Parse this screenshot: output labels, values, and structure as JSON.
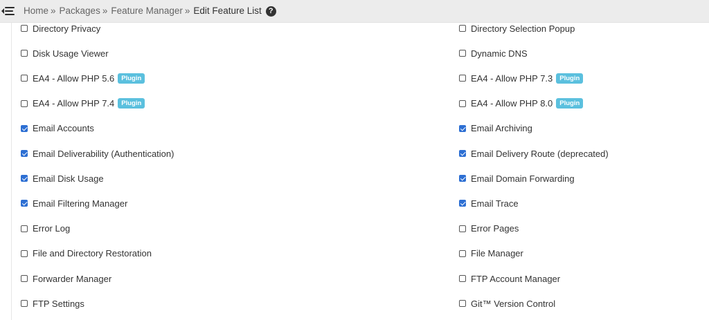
{
  "breadcrumb": {
    "home": "Home",
    "packages": "Packages",
    "feature_manager": "Feature Manager",
    "current": "Edit Feature List",
    "separator": "»"
  },
  "icons": {
    "menu": "menu-toggle-icon",
    "help": "question-circle-icon"
  },
  "help_glyph": "?",
  "colors": {
    "checkbox_checked": "#2d6fd3",
    "plugin_badge": "#5bc0de",
    "topbar": "#ececec"
  },
  "features": {
    "left": [
      {
        "label": "Directory Privacy",
        "checked": false,
        "badge": ""
      },
      {
        "label": "Disk Usage Viewer",
        "checked": false,
        "badge": ""
      },
      {
        "label": "EA4 - Allow PHP 5.6",
        "checked": false,
        "badge": "Plugin"
      },
      {
        "label": "EA4 - Allow PHP 7.4",
        "checked": false,
        "badge": "Plugin"
      },
      {
        "label": "Email Accounts",
        "checked": true,
        "badge": ""
      },
      {
        "label": "Email Deliverability (Authentication)",
        "checked": true,
        "badge": ""
      },
      {
        "label": "Email Disk Usage",
        "checked": true,
        "badge": ""
      },
      {
        "label": "Email Filtering Manager",
        "checked": true,
        "badge": ""
      },
      {
        "label": "Error Log",
        "checked": false,
        "badge": ""
      },
      {
        "label": "File and Directory Restoration",
        "checked": false,
        "badge": ""
      },
      {
        "label": "Forwarder Manager",
        "checked": false,
        "badge": ""
      },
      {
        "label": "FTP Settings",
        "checked": false,
        "badge": ""
      }
    ],
    "right": [
      {
        "label": "Directory Selection Popup",
        "checked": false,
        "badge": ""
      },
      {
        "label": "Dynamic DNS",
        "checked": false,
        "badge": ""
      },
      {
        "label": "EA4 - Allow PHP 7.3",
        "checked": false,
        "badge": "Plugin"
      },
      {
        "label": "EA4 - Allow PHP 8.0",
        "checked": false,
        "badge": "Plugin"
      },
      {
        "label": "Email Archiving",
        "checked": true,
        "badge": ""
      },
      {
        "label": "Email Delivery Route (deprecated)",
        "checked": true,
        "badge": ""
      },
      {
        "label": "Email Domain Forwarding",
        "checked": true,
        "badge": ""
      },
      {
        "label": "Email Trace",
        "checked": true,
        "badge": ""
      },
      {
        "label": "Error Pages",
        "checked": false,
        "badge": ""
      },
      {
        "label": "File Manager",
        "checked": false,
        "badge": ""
      },
      {
        "label": "FTP Account Manager",
        "checked": false,
        "badge": ""
      },
      {
        "label": "Git™ Version Control",
        "checked": false,
        "badge": ""
      }
    ]
  }
}
